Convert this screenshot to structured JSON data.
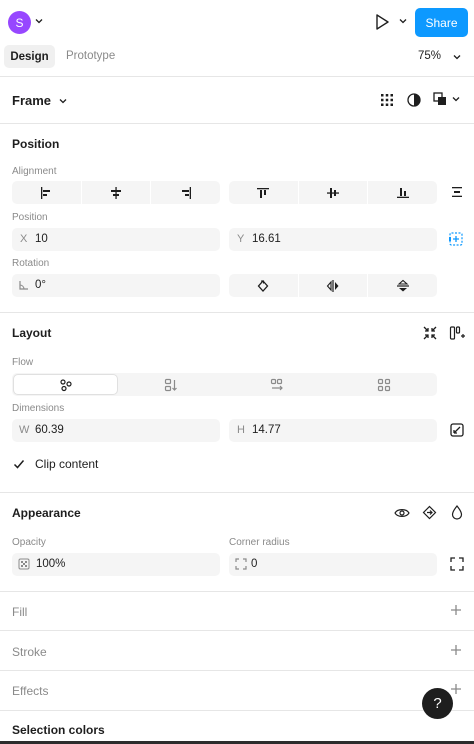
{
  "header": {
    "avatar_initial": "S",
    "share_label": "Share",
    "tabs": [
      {
        "label": "Design",
        "active": true
      },
      {
        "label": "Prototype",
        "active": false
      }
    ],
    "zoom": "75%"
  },
  "frame": {
    "label": "Frame"
  },
  "position": {
    "title": "Position",
    "alignment_label": "Alignment",
    "position_label": "Position",
    "x_prefix": "X",
    "x_value": "10",
    "y_prefix": "Y",
    "y_value": "16.61",
    "rotation_label": "Rotation",
    "rotation_value": "0°"
  },
  "layout": {
    "title": "Layout",
    "flow_label": "Flow",
    "dimensions_label": "Dimensions",
    "w_prefix": "W",
    "w_value": "60.39",
    "h_prefix": "H",
    "h_value": "14.77",
    "clip_content_label": "Clip content",
    "clip_content_checked": true
  },
  "appearance": {
    "title": "Appearance",
    "opacity_label": "Opacity",
    "opacity_value": "100%",
    "corner_radius_label": "Corner radius",
    "corner_radius_value": "0"
  },
  "fill": {
    "title": "Fill"
  },
  "stroke": {
    "title": "Stroke"
  },
  "effects": {
    "title": "Effects"
  },
  "selection_colors": {
    "title": "Selection colors"
  },
  "help": {
    "label": "?"
  },
  "colors": {
    "accent": "#0d99ff",
    "avatar": "#9747ff",
    "help_bg": "#1e1e1e"
  }
}
